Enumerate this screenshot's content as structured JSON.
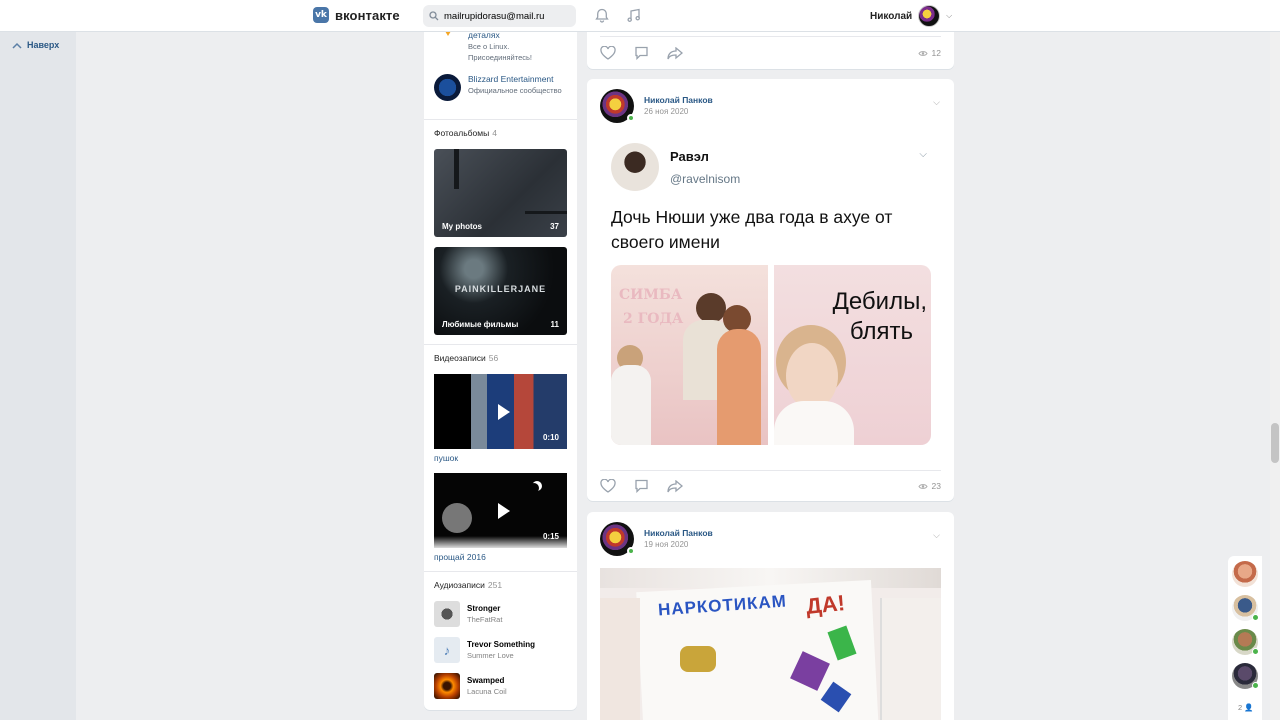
{
  "header": {
    "logo_mark": "vk",
    "logo_text": "вконтакте",
    "search_value": "mailrupidorasu@mail.ru",
    "user_name": "Николай"
  },
  "left": {
    "back_top": "Наверх"
  },
  "groups": [
    {
      "title": "деталях",
      "sub": "Все о Linux. Присоединяйтесь!"
    },
    {
      "title": "Blizzard Entertainment",
      "sub": "Официальное сообщество"
    }
  ],
  "photos": {
    "heading": "Фотоальбомы",
    "count": "4",
    "albums": [
      {
        "title": "My photos",
        "count": "37"
      },
      {
        "title": "Любимые фильмы",
        "count": "11",
        "overlay": "PAINKILLERJANE"
      }
    ]
  },
  "videos": {
    "heading": "Видеозаписи",
    "count": "56",
    "items": [
      {
        "title": "пушок",
        "duration": "0:10"
      },
      {
        "title": "прощай 2016",
        "duration": "0:15"
      }
    ]
  },
  "audio": {
    "heading": "Аудиозаписи",
    "count": "251",
    "items": [
      {
        "title": "Stronger",
        "artist": "TheFatRat"
      },
      {
        "title": "Trevor Something",
        "artist": "Summer Love"
      },
      {
        "title": "Swamped",
        "artist": "Lacuna Coil"
      }
    ]
  },
  "feed": {
    "top_views": "12",
    "posts": [
      {
        "author": "Николай Панков",
        "date": "26 ноя 2020",
        "views": "23",
        "tweet": {
          "name": "Равэл",
          "handle": "@ravelnisom",
          "text": "Дочь Нюши уже два года в ахуе от своего имени",
          "sign_line1": "СИМБА",
          "sign_line2": "2 ГОДА",
          "meme_line1": "Дебилы,",
          "meme_line2": "блять"
        }
      },
      {
        "author": "Николай Панков",
        "date": "19 ноя 2020",
        "poster_text": "НАРКОТИКАМ",
        "poster_da": "ДА!"
      }
    ]
  },
  "chats": {
    "count": "2"
  },
  "colors": {
    "accent": "#2a5885",
    "brand": "#4a76a8",
    "online": "#4bb34b"
  }
}
